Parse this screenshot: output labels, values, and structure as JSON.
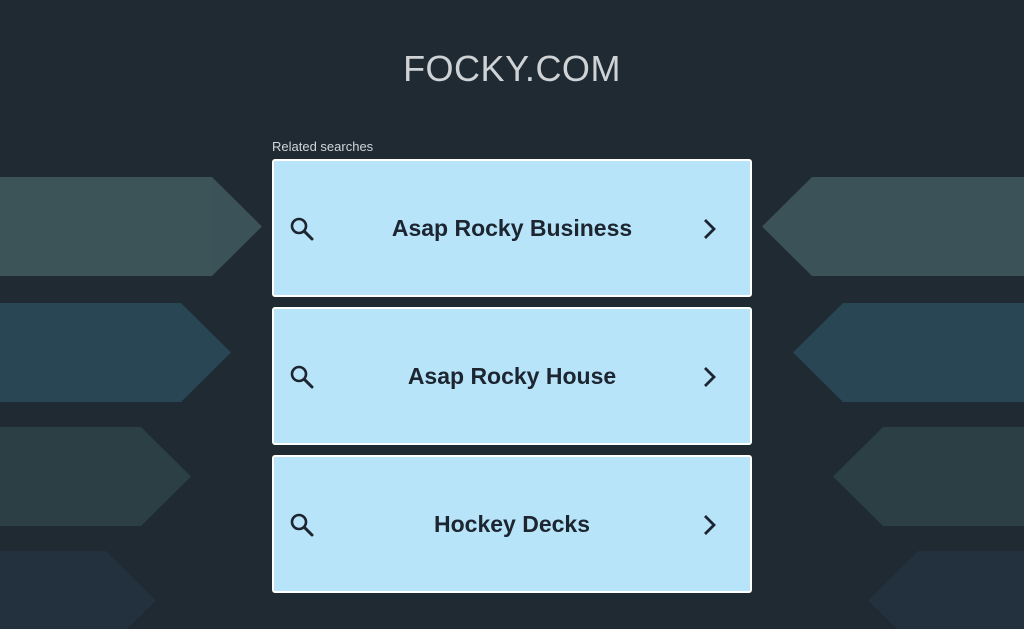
{
  "site": {
    "title": "FOCKY.COM"
  },
  "related": {
    "label": "Related searches",
    "items": [
      {
        "label": "Asap Rocky Business"
      },
      {
        "label": "Asap Rocky House"
      },
      {
        "label": "Hockey Decks"
      }
    ]
  },
  "icons": {
    "search": "search-icon",
    "chevron": "chevron-right-icon"
  },
  "colors": {
    "background": "#1f2a33",
    "card": "#b7e4f9",
    "card_border": "#ffffff",
    "card_text": "#1c2530",
    "title": "#cfd3d6",
    "deco_1": "#3a5258",
    "deco_2": "#294654",
    "deco_3": "#2b3f45",
    "deco_4": "#22313d"
  }
}
